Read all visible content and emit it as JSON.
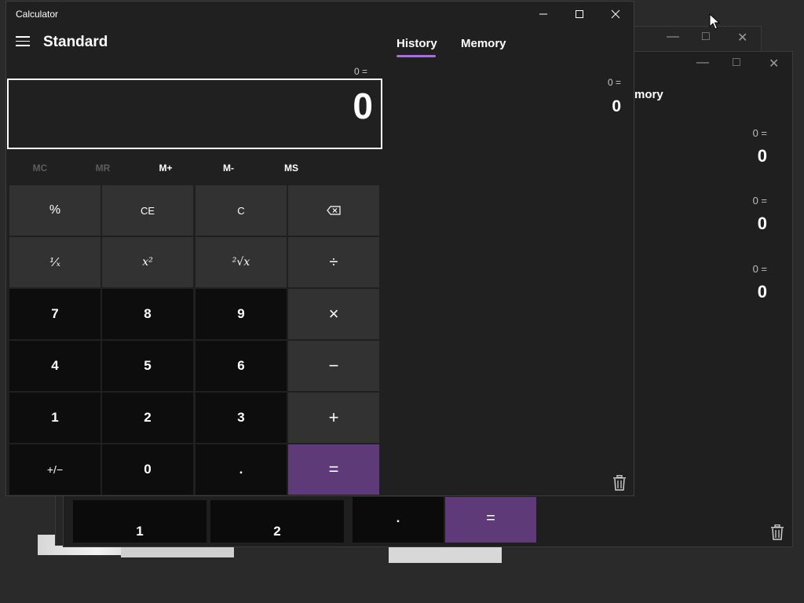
{
  "app": {
    "title": "Calculator",
    "mode": "Standard"
  },
  "display": {
    "expression": "0 =",
    "value": "0"
  },
  "memory_buttons": [
    "MC",
    "MR",
    "M+",
    "M-",
    "MS"
  ],
  "keys": {
    "percent": "%",
    "ce": "CE",
    "c": "C",
    "reciprocal": "¹⁄ₓ",
    "square": "x²",
    "sqrt": "²√x",
    "divide": "÷",
    "multiply": "×",
    "minus": "−",
    "plus": "+",
    "equals": "=",
    "seven": "7",
    "eight": "8",
    "nine": "9",
    "four": "4",
    "five": "5",
    "six": "6",
    "one": "1",
    "two": "2",
    "three": "3",
    "negate": "+/−",
    "zero": "0",
    "decimal": "."
  },
  "panel": {
    "tabs": [
      "History",
      "Memory"
    ],
    "active_tab": "History"
  },
  "history": [
    {
      "expression": "0 =",
      "value": "0"
    }
  ],
  "background_window": {
    "tab_fragment": "mory",
    "history": [
      {
        "expression": "0 =",
        "value": "0"
      },
      {
        "expression": "0 =",
        "value": "0"
      },
      {
        "expression": "0 =",
        "value": "0"
      }
    ],
    "keys": [
      "1",
      "2",
      ".",
      "="
    ]
  },
  "colors": {
    "window_bg": "#202020",
    "accent": "#a971cf",
    "equals_key": "#5e3a78",
    "number_key": "#0d0d0d"
  }
}
